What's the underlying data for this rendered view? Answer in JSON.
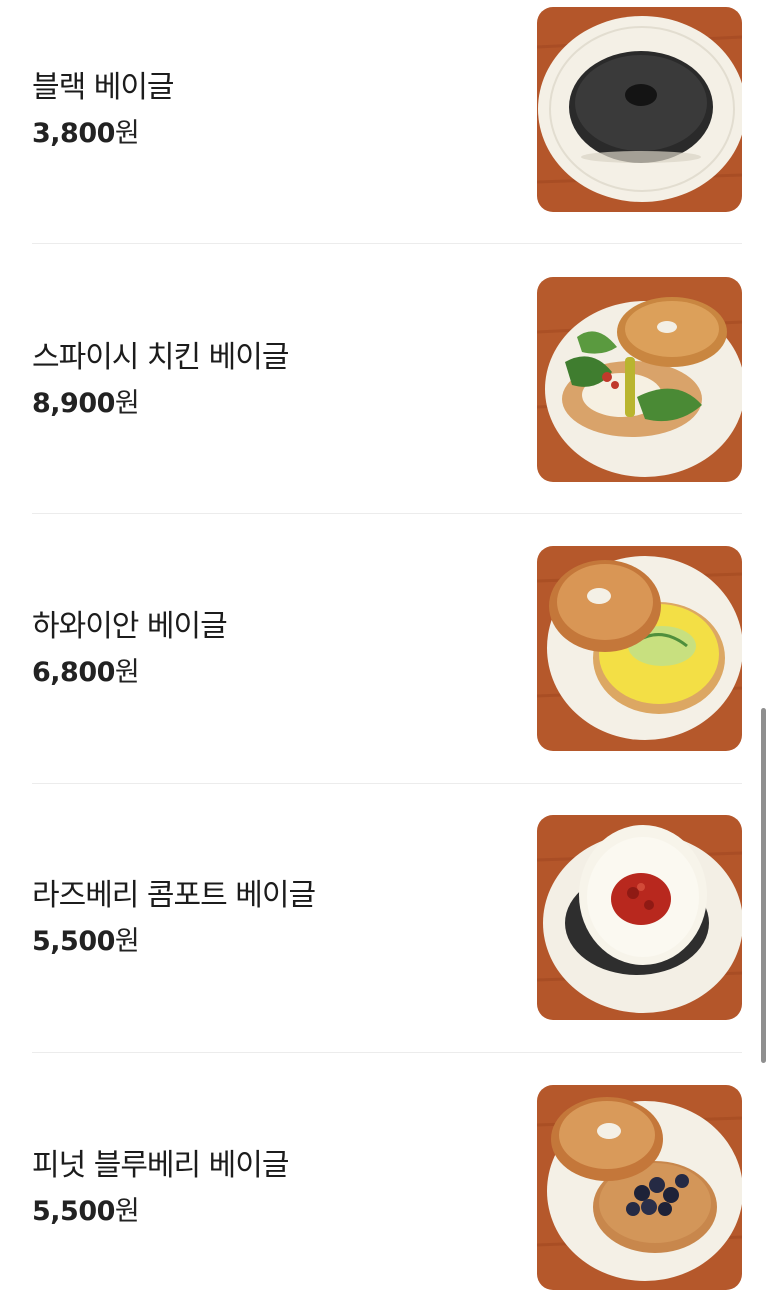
{
  "menu": {
    "items": [
      {
        "name": "블랙 베이글",
        "price": "3,800",
        "currency": "원",
        "image": "black-bagel-photo"
      },
      {
        "name": "스파이시 치킨 베이글",
        "price": "8,900",
        "currency": "원",
        "image": "spicy-chicken-bagel-photo"
      },
      {
        "name": "하와이안 베이글",
        "price": "6,800",
        "currency": "원",
        "image": "hawaiian-bagel-photo"
      },
      {
        "name": "라즈베리 콤포트 베이글",
        "price": "5,500",
        "currency": "원",
        "image": "raspberry-compote-bagel-photo"
      },
      {
        "name": "피넛 블루베리 베이글",
        "price": "5,500",
        "currency": "원",
        "image": "peanut-blueberry-bagel-photo"
      }
    ]
  },
  "colors": {
    "background": "#ffffff",
    "text": "#1c1c1c",
    "divider": "#ececec",
    "table_wood": "#b8582a",
    "plate": "#f3efe6"
  }
}
